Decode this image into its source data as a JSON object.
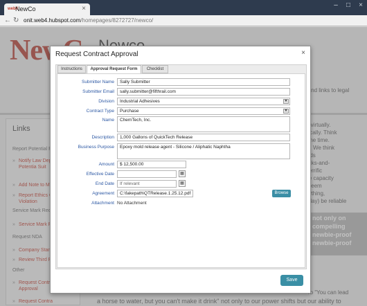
{
  "browser": {
    "tab_favicon_text": "web4",
    "tab_title": "NewCo",
    "tab_close": "×",
    "url_host": "onit.web4.hubspot.com",
    "url_path": "/homepages/8272727/newco/"
  },
  "site": {
    "logo": "NewCo",
    "brand": "Newco",
    "intro_fragment": "n and links to legal",
    "sidebar": {
      "title": "Links",
      "sections": [
        {
          "label": "Report Potential F",
          "links": [
            "Notify Law Dep Claim, Potentia Suit",
            "Add Note to Ma",
            "Report Ethics C Violation"
          ]
        },
        {
          "label": "Service Mark Rec",
          "links": [
            "Service Mark R"
          ]
        },
        {
          "label": "Request NDA",
          "links": [
            "Company Stan",
            "Review Third P"
          ]
        },
        {
          "label": "Other",
          "links": [
            "Request Contra Approval",
            "Request Contra"
          ]
        }
      ]
    },
    "body_lines": [
      "alize virtually.",
      "ategically. Think",
      "e same time.",
      "tively. We think",
      "sounds",
      "d bricks-and-",
      "d a terrific",
      "t. The capacity",
      "nay seem",
      "everything,",
      "one day) be reliable"
    ],
    "callout_lines": [
      "not only on",
      "compelling",
      "newbie-proof",
      "newbie-proof"
    ],
    "bottom_text": "a horse to water, but you can't make it drink\" not only to our power shifts but our ability to",
    "bottom_text_right": "rb \"You can lead"
  },
  "modal": {
    "title": "Request Contract Approval",
    "close": "×",
    "tabs": [
      "Instructions",
      "Approval Request Form",
      "Checklist"
    ],
    "active_tab": "Approval Request Form",
    "fields": {
      "submitter_name": {
        "label": "Submitter Name",
        "value": "Sally Submitter"
      },
      "submitter_email": {
        "label": "Submitter Email",
        "value": "sally.submitter@fifthrail.com"
      },
      "division": {
        "label": "Division",
        "value": "Industrial Adhesives"
      },
      "contract_type": {
        "label": "Contract Type",
        "value": "Purchase"
      },
      "name": {
        "label": "Name",
        "value": "ChemTech, Inc."
      },
      "description": {
        "label": "Description",
        "value": "1,000 Gallons of QuickTech Release"
      },
      "business_purpose": {
        "label": "Business Purpose",
        "value": "Epoxy mold release agent - Silicone / Aliphatic Naphtha"
      },
      "amount": {
        "label": "Amount",
        "value": "$ 12,500.00"
      },
      "effective_date": {
        "label": "Effective Date",
        "value": ""
      },
      "end_date": {
        "label": "End Date",
        "value": "If relevant"
      },
      "agreement": {
        "label": "Agreement",
        "value": "C:\\fakepath\\QTRelease.1.25.12.pdf"
      },
      "attachment": {
        "label": "Attachment",
        "value": "No Attachment"
      }
    },
    "browse_label": "Browse",
    "save_label": "Save"
  }
}
